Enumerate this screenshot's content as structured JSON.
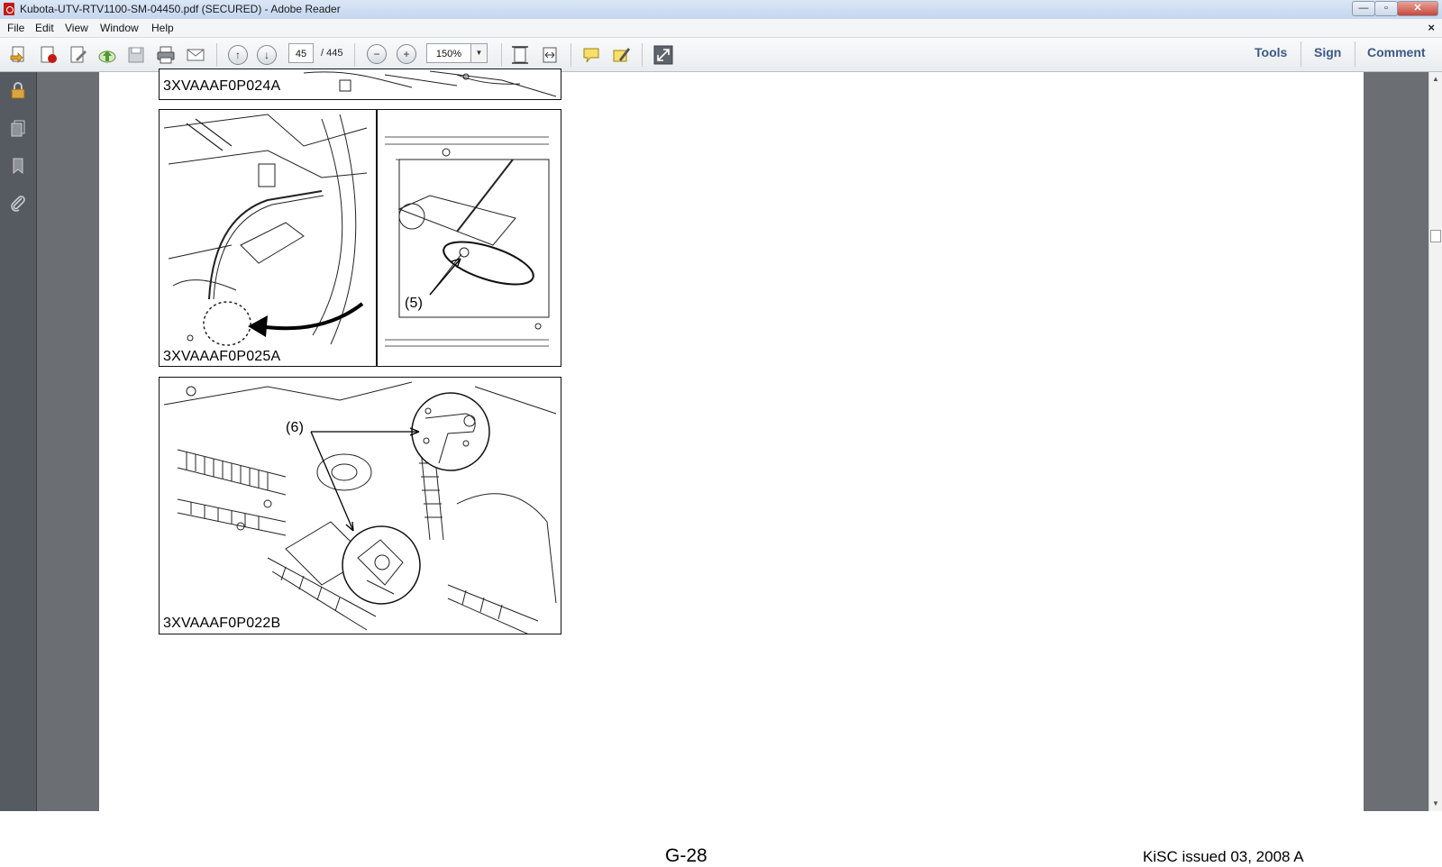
{
  "window": {
    "title": "Kubota-UTV-RTV1100-SM-04450.pdf (SECURED) - Adobe Reader",
    "controls": {
      "minimize": "—",
      "maximize": "▫",
      "close": "✕"
    }
  },
  "menu": {
    "items": [
      "File",
      "Edit",
      "View",
      "Window",
      "Help"
    ],
    "close_doc": "×"
  },
  "toolbar": {
    "page_number": "45",
    "page_total": "/ 445",
    "zoom": "150%",
    "zoom_drop": "▼",
    "prev_glyph": "↑",
    "next_glyph": "↓",
    "zoom_out_glyph": "−",
    "zoom_in_glyph": "+",
    "right_buttons": [
      "Tools",
      "Sign",
      "Comment"
    ]
  },
  "document": {
    "figures": [
      {
        "code": "3XVAAAF0P024A"
      },
      {
        "code": "3XVAAAF0P025A",
        "callout": "(5)"
      },
      {
        "code": "3XVAAAF0P022B",
        "callout": "(6)"
      }
    ],
    "footer_page": "G-28",
    "footer_issue": "KiSC issued 03, 2008 A"
  },
  "scrollbar": {
    "up": "▲",
    "down": "▼"
  },
  "colors": {
    "pdf_red": "#c21b17",
    "toolbar_link": "#3c5a86",
    "nav_pane": "#565a61",
    "doc_background": "#6b6e73"
  }
}
